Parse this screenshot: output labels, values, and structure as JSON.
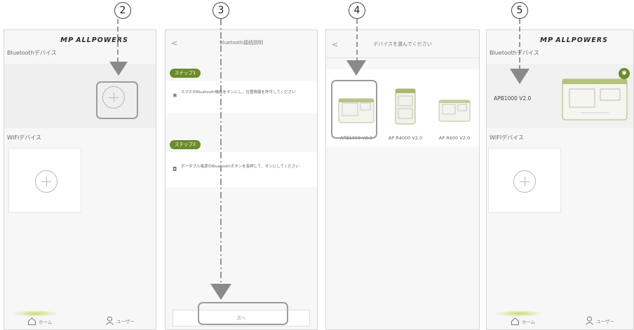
{
  "step_numbers": [
    "2",
    "3",
    "4",
    "5"
  ],
  "brand": {
    "mark": "MP",
    "name": "ALLPOWERS"
  },
  "home": {
    "bluetooth_label": "Bluetoothデバイス",
    "wifi_label": "WIFIデバイス",
    "nav_home": "ホーム",
    "nav_user": "ユーザー"
  },
  "instructions": {
    "title": "Bluetooth接続説明",
    "step1_label": "ステップ1",
    "step1_text": "スマホのBluetooth機能をオンにし、位置情報を許可してください",
    "step2_label": "ステップ2",
    "step2_text": "ポータブル電源のBluetoothボタンを長押して、オンにしてください",
    "next_label": "次へ"
  },
  "select": {
    "title": "デバイスを選んでください",
    "devices": [
      "APB1000 V2.0",
      "AP R4000 V2.0",
      "AP R600 V2.0"
    ]
  },
  "result": {
    "device_name": "APB1000 V2.0"
  },
  "colors": {
    "accent": "#6b8c2b",
    "highlight": "#9c9c9c",
    "arrow": "#8a8a8a"
  }
}
